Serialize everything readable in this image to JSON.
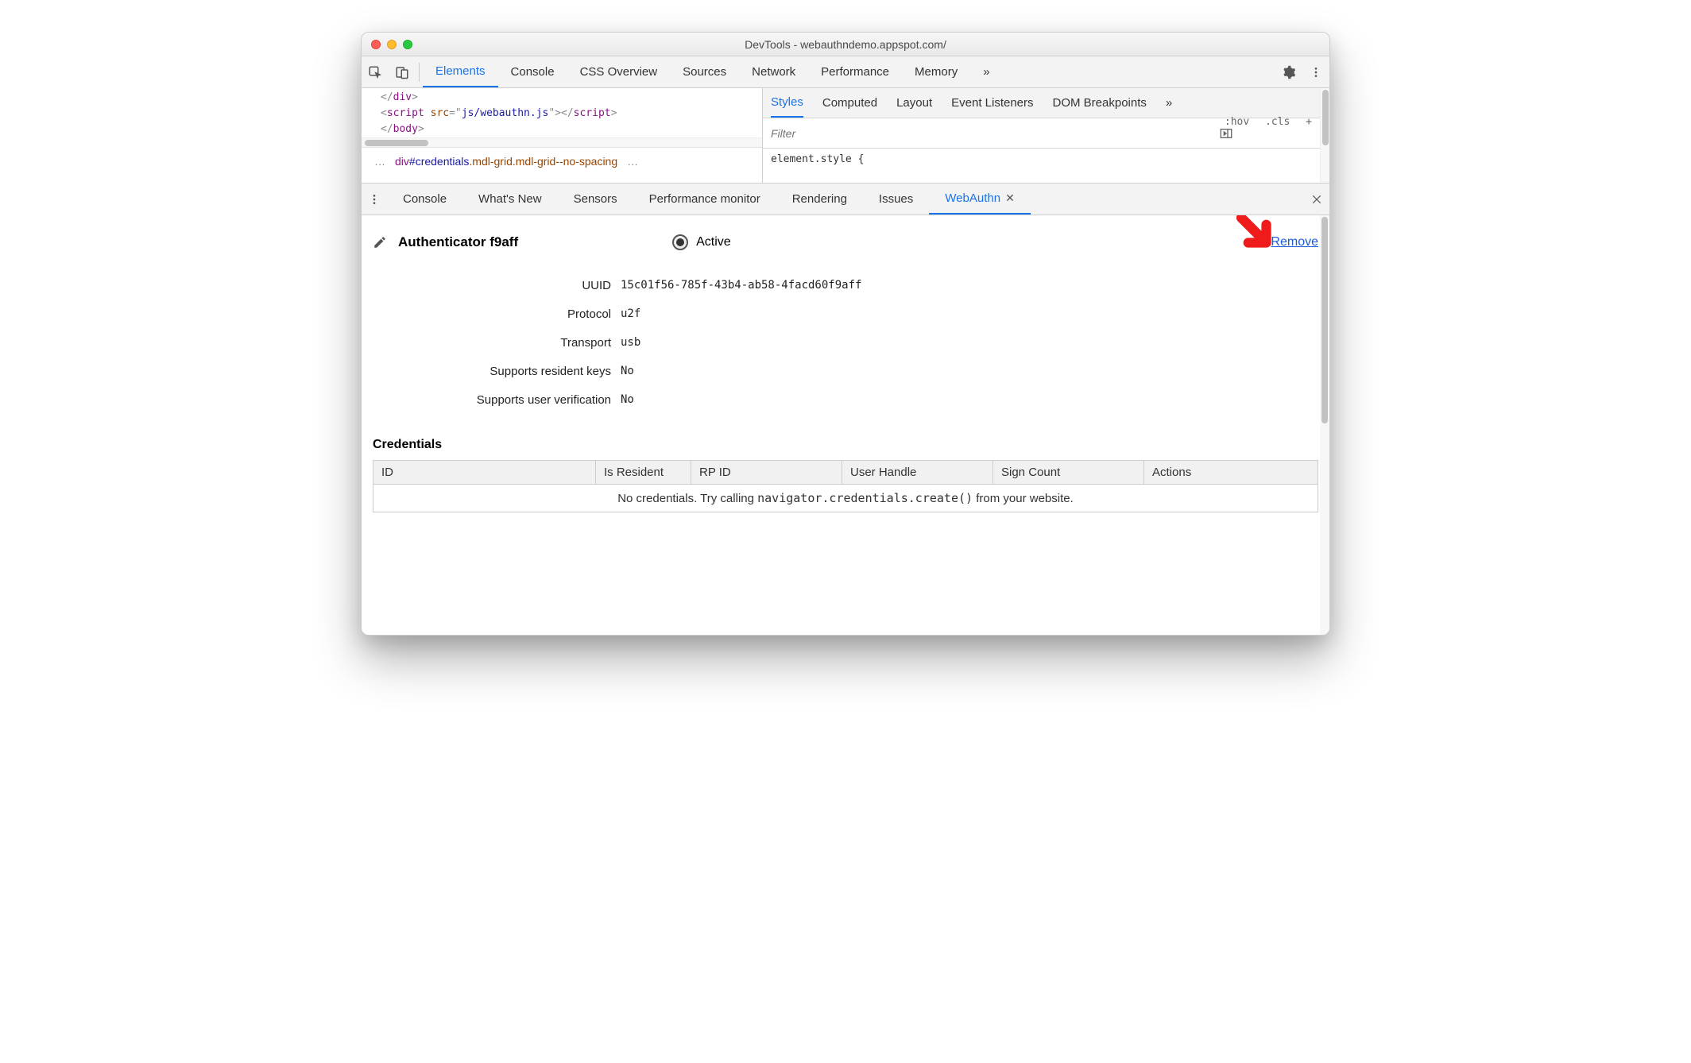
{
  "window": {
    "title": "DevTools - webauthndemo.appspot.com/"
  },
  "main_tabs": [
    "Elements",
    "Console",
    "CSS Overview",
    "Sources",
    "Network",
    "Performance",
    "Memory"
  ],
  "main_tabs_active": 0,
  "main_tabs_overflow": "»",
  "elements_pane": {
    "lines": [
      {
        "indent": 1,
        "html": "</div>"
      },
      {
        "indent": 1,
        "html": "<script src=\"js/webauthn.js\">"
      },
      {
        "indent": 0,
        "html": "</body>"
      }
    ],
    "breadcrumb_dots": "…",
    "breadcrumb_tag": "div",
    "breadcrumb_id": "#credentials",
    "breadcrumb_classes": ".mdl-grid.mdl-grid--no-spacing",
    "breadcrumb_trailing": "…"
  },
  "styles_pane": {
    "tabs": [
      "Styles",
      "Computed",
      "Layout",
      "Event Listeners",
      "DOM Breakpoints"
    ],
    "tabs_overflow": "»",
    "tabs_active": 0,
    "filter_placeholder": "Filter",
    "chips": [
      ":hov",
      ".cls",
      "+"
    ],
    "style_block": "element.style {"
  },
  "drawer": {
    "tabs": [
      "Console",
      "What's New",
      "Sensors",
      "Performance monitor",
      "Rendering",
      "Issues",
      "WebAuthn"
    ],
    "active": 6
  },
  "webauthn": {
    "title": "Authenticator f9aff",
    "active_label": "Active",
    "remove_label": "Remove",
    "props": [
      {
        "k": "UUID",
        "v": "15c01f56-785f-43b4-ab58-4facd60f9aff"
      },
      {
        "k": "Protocol",
        "v": "u2f"
      },
      {
        "k": "Transport",
        "v": "usb"
      },
      {
        "k": "Supports resident keys",
        "v": "No"
      },
      {
        "k": "Supports user verification",
        "v": "No"
      }
    ],
    "credentials_heading": "Credentials",
    "table_headers": [
      "ID",
      "Is Resident",
      "RP ID",
      "User Handle",
      "Sign Count",
      "Actions"
    ],
    "empty_pre": "No credentials. Try calling ",
    "empty_code": "navigator.credentials.create()",
    "empty_post": " from your website."
  }
}
